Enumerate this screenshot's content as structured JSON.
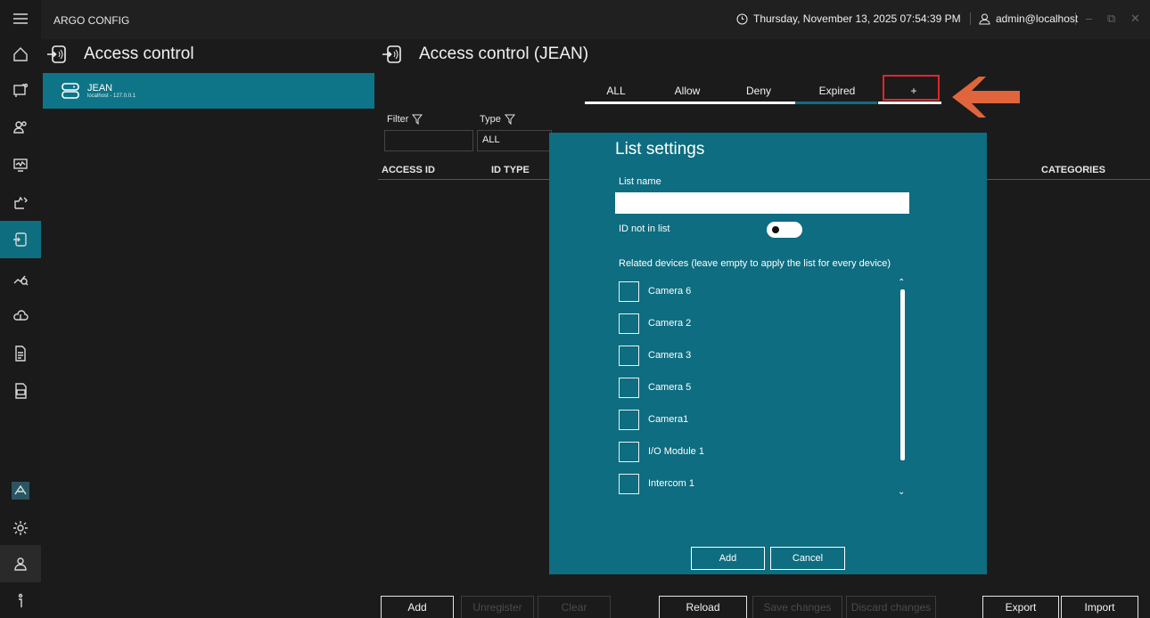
{
  "app": {
    "title": "ARGO CONFIG"
  },
  "status": {
    "datetime": "Thursday, November 13, 2025 07:54:39 PM",
    "user": "admin@localhost"
  },
  "rail": {
    "items": [
      {
        "name": "menu-icon"
      },
      {
        "name": "home-icon"
      },
      {
        "name": "devices-icon"
      },
      {
        "name": "users-icon"
      },
      {
        "name": "monitor-icon"
      },
      {
        "name": "rules-icon"
      },
      {
        "name": "access-control-icon",
        "active": true
      },
      {
        "name": "analytics-icon"
      },
      {
        "name": "cloud-icon"
      },
      {
        "name": "report-icon"
      },
      {
        "name": "log-icon"
      },
      {
        "name": "argo-icon",
        "label": "Argo"
      },
      {
        "name": "settings-icon"
      },
      {
        "name": "account-icon"
      },
      {
        "name": "info-icon"
      }
    ]
  },
  "left_panel": {
    "title": "Access control",
    "node": {
      "name": "JEAN",
      "subtitle": "localhost - 127.0.0.1"
    }
  },
  "main": {
    "title": "Access control (JEAN)",
    "tabs": [
      {
        "label": "ALL",
        "color": "#ffffff"
      },
      {
        "label": "Allow",
        "color": "#ffffff"
      },
      {
        "label": "Deny",
        "color": "#ffffff"
      },
      {
        "label": "Expired",
        "color": "#0e6e80"
      },
      {
        "label": "+",
        "color": "#ffffff"
      }
    ],
    "filter": {
      "label": "Filter",
      "value": ""
    },
    "type": {
      "label": "Type",
      "value": "ALL"
    },
    "columns": {
      "access_id": "ACCESS ID",
      "id_type": "ID TYPE",
      "categories": "CATEGORIES"
    },
    "buttons": {
      "add": "Add",
      "unregister": "Unregister",
      "clear": "Clear",
      "reload": "Reload",
      "save_changes": "Save changes",
      "discard_changes": "Discard changes",
      "export": "Export",
      "import": "Import"
    }
  },
  "dialog": {
    "title": "List settings",
    "list_name_label": "List name",
    "list_name_value": "",
    "id_not_in_list_label": "ID not in list",
    "id_not_in_list_on": true,
    "related_devices_label": "Related devices (leave empty to apply the list for every device)",
    "devices": [
      {
        "name": "Camera 6",
        "checked": false
      },
      {
        "name": "Camera 2",
        "checked": false
      },
      {
        "name": "Camera 3",
        "checked": false
      },
      {
        "name": "Camera 5",
        "checked": false
      },
      {
        "name": "Camera1",
        "checked": false
      },
      {
        "name": "I/O Module 1",
        "checked": false
      },
      {
        "name": "Intercom 1",
        "checked": false
      }
    ],
    "add_label": "Add",
    "cancel_label": "Cancel"
  },
  "colors": {
    "accent": "#0e6e80",
    "dialog": "#0e6d80",
    "highlight": "#e0262b",
    "arrow": "#e0653c"
  }
}
